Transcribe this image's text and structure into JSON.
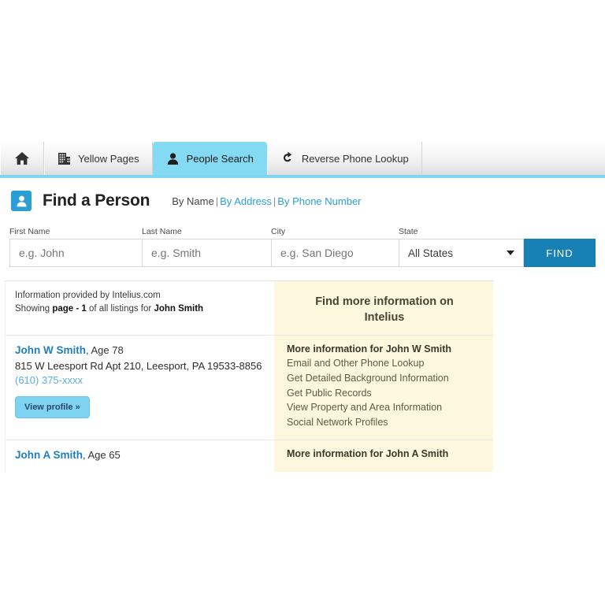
{
  "tabs": [
    {
      "id": "home",
      "label": "",
      "icon": "home-icon",
      "active": false
    },
    {
      "id": "yellow-pages",
      "label": "Yellow Pages",
      "icon": "building-icon",
      "active": false
    },
    {
      "id": "people-search",
      "label": "People Search",
      "icon": "person-icon",
      "active": true
    },
    {
      "id": "reverse-phone-lookup",
      "label": "Reverse Phone Lookup",
      "icon": "reload-arrow-icon",
      "active": false
    }
  ],
  "header": {
    "title": "Find a Person",
    "badge_icon": "person-badge-icon",
    "by_name": "By Name",
    "by_address": "By Address",
    "by_phone": "By Phone Number",
    "separator": "|"
  },
  "form": {
    "first_name_label": "First Name",
    "last_name_label": "Last Name",
    "city_label": "City",
    "state_label": "State",
    "first_name_placeholder": "e.g. John",
    "last_name_placeholder": "e.g. Smith",
    "city_placeholder": "e.g. San Diego",
    "first_name_value": "",
    "last_name_value": "",
    "city_value": "",
    "state_selected": "All States",
    "find_label": "FIND"
  },
  "info": {
    "provided_by": "Information provided by Intelius.com",
    "showing_prefix": "Showing ",
    "showing_page": "page - 1",
    "showing_mid": " of all listings for ",
    "showing_query": "John Smith",
    "promo_line1": "Find more information on",
    "promo_line2": "Intelius"
  },
  "results": [
    {
      "name": "John W Smith",
      "age": ", Age 78",
      "address": "815 W Leesport Rd Apt 210, Leesport, PA 19533-8856",
      "phone": "(610) 375-xxxx",
      "view_profile": "View profile »",
      "more_title": "More information for John W Smith",
      "more_items": [
        "Email and Other Phone Lookup",
        "Get Detailed Background Information",
        "Get Public Records",
        "View Property and Area Information",
        "Social Network Profiles"
      ]
    },
    {
      "name": "John A Smith",
      "age": ", Age 65",
      "address": "",
      "phone": "",
      "view_profile": "",
      "more_title": "More information for John A Smith",
      "more_items": []
    }
  ],
  "colors": {
    "accent_blue": "#2a9fd6",
    "tab_active": "#84d9f3",
    "tab_underline": "#7fd4ef",
    "find_button": "#1781b5",
    "promo_bg": "#fcf8dd",
    "link": "#1f7fc0"
  }
}
